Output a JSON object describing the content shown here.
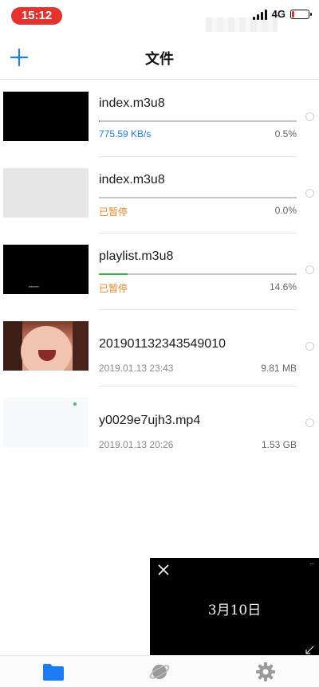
{
  "status_bar": {
    "time": "15:12",
    "network": "4G",
    "time_bg_color": "#e5322d"
  },
  "nav": {
    "title": "文件",
    "add_icon": "plus-icon",
    "accent_color": "#1b7cf3"
  },
  "files": [
    {
      "name": "index.m3u8",
      "status_text": "775.59 KB/s",
      "status_type": "speed",
      "progress_text": "0.5%",
      "progress": 0.005,
      "thumb": "black"
    },
    {
      "name": "index.m3u8",
      "status_text": "已暂停",
      "status_type": "paused",
      "progress_text": "0.0%",
      "progress": 0.0,
      "thumb": "gray"
    },
    {
      "name": "playlist.m3u8",
      "status_text": "已暂停",
      "status_type": "paused",
      "progress_text": "14.6%",
      "progress": 0.146,
      "thumb": "black"
    },
    {
      "name": "201901132343549010",
      "date": "2019.01.13 23:43",
      "size": "9.81 MB",
      "thumb": "face"
    },
    {
      "name": "y0029e7ujh3.mp4",
      "date": "2019.01.13 20:26",
      "size": "1.53 GB",
      "thumb": "white"
    }
  ],
  "floating_video": {
    "caption": "3月10日",
    "close_icon": "close-icon"
  },
  "tab_bar": {
    "items": [
      {
        "icon": "folder-icon",
        "active": true
      },
      {
        "icon": "planet-icon",
        "active": false
      },
      {
        "icon": "gear-icon",
        "active": false
      }
    ],
    "active_color": "#1b7cf3",
    "inactive_color": "#9a9a9a"
  }
}
